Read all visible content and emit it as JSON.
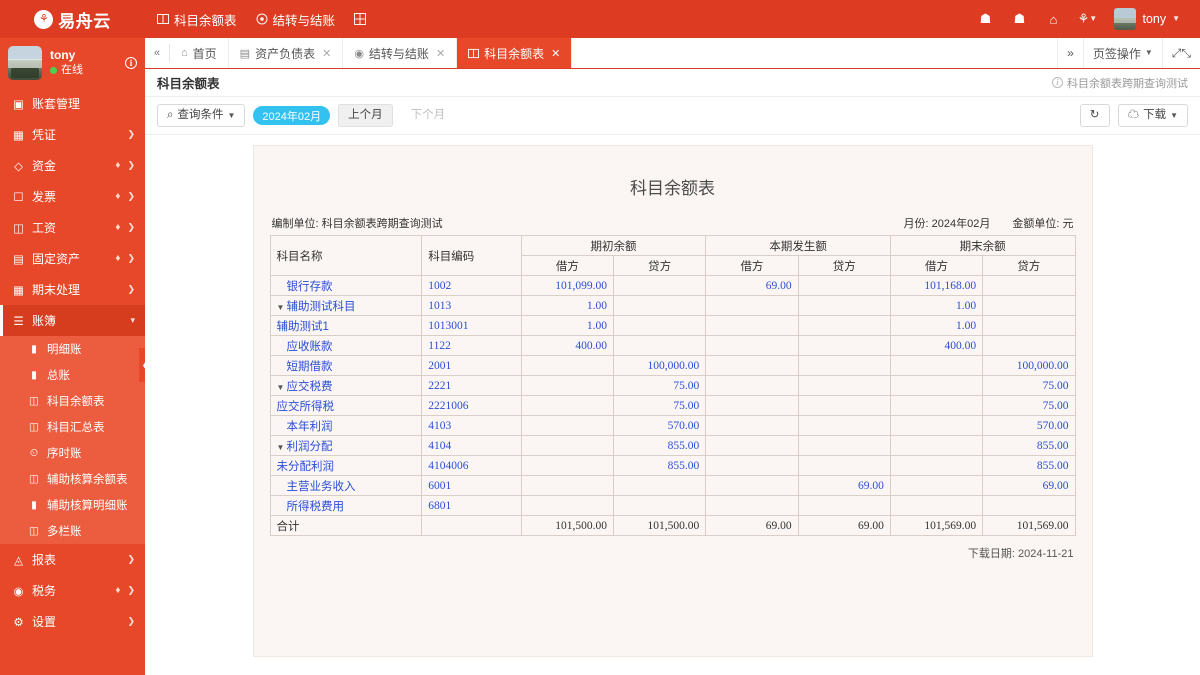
{
  "brand": {
    "name": "易舟云",
    "logo_icon": "seal-logo-icon"
  },
  "topnav": [
    {
      "label": "科目余额表",
      "icon": "columns-icon"
    },
    {
      "label": "结转与结账",
      "icon": "target-icon"
    },
    {
      "label": "",
      "icon": "grid-plus-icon"
    }
  ],
  "topright": {
    "icons": [
      {
        "name": "alert-icon",
        "glyph": "☗"
      },
      {
        "name": "bug-icon",
        "glyph": "☗"
      },
      {
        "name": "home-icon",
        "glyph": "⌂"
      },
      {
        "name": "apps-icon",
        "glyph": "⚘"
      }
    ],
    "user": "tony"
  },
  "sidebar": {
    "profile": {
      "name": "tony",
      "status": "在线",
      "info_icon": "info-icon"
    },
    "items": [
      {
        "label": "账套管理",
        "icon": "book-icon",
        "arrow": false,
        "vip": false
      },
      {
        "label": "凭证",
        "icon": "voucher-icon",
        "arrow": true,
        "vip": false
      },
      {
        "label": "资金",
        "icon": "money-icon",
        "arrow": true,
        "vip": true
      },
      {
        "label": "发票",
        "icon": "invoice-icon",
        "arrow": true,
        "vip": true
      },
      {
        "label": "工资",
        "icon": "salary-icon",
        "arrow": true,
        "vip": true
      },
      {
        "label": "固定资产",
        "icon": "asset-icon",
        "arrow": true,
        "vip": true
      },
      {
        "label": "期末处理",
        "icon": "calendar-icon",
        "arrow": true,
        "vip": false
      },
      {
        "label": "账簿",
        "icon": "ledger-icon",
        "arrow": true,
        "vip": false,
        "active": true
      }
    ],
    "submenu": [
      {
        "label": "明细账",
        "icon": "bookmark-icon"
      },
      {
        "label": "总账",
        "icon": "bookmark-icon"
      },
      {
        "label": "科目余额表",
        "icon": "columns-icon"
      },
      {
        "label": "科目汇总表",
        "icon": "columns-icon"
      },
      {
        "label": "序时账",
        "icon": "clock-icon"
      },
      {
        "label": "辅助核算余额表",
        "icon": "columns-icon"
      },
      {
        "label": "辅助核算明细账",
        "icon": "bookmark-icon"
      },
      {
        "label": "多栏账",
        "icon": "columns-icon"
      }
    ],
    "items_after": [
      {
        "label": "报表",
        "icon": "chart-icon",
        "arrow": true,
        "vip": false
      },
      {
        "label": "税务",
        "icon": "tax-icon",
        "arrow": true,
        "vip": true
      },
      {
        "label": "设置",
        "icon": "gear-icon",
        "arrow": true,
        "vip": false
      }
    ],
    "collapse_handle": "❮"
  },
  "tabbar": {
    "prev_icon": "double-chevron-left-icon",
    "tabs": [
      {
        "label": "首页",
        "icon": "home-icon",
        "closable": false,
        "active": false
      },
      {
        "label": "资产负债表",
        "icon": "balance-icon",
        "closable": true,
        "active": false
      },
      {
        "label": "结转与结账",
        "icon": "target-icon",
        "closable": true,
        "active": false
      },
      {
        "label": "科目余额表",
        "icon": "columns-icon",
        "closable": true,
        "active": true
      }
    ],
    "next_icon": "double-chevron-right-icon",
    "tab_action_label": "页签操作",
    "fullscreen_icon": "fullscreen-icon",
    "close_label": "×"
  },
  "pagehead": {
    "title": "科目余额表",
    "note": "科目余额表跨期查询测试"
  },
  "toolbar": {
    "query_label": "查询条件",
    "period": "2024年02月",
    "prev_month": "上个月",
    "next_month": "下个月",
    "refresh_icon": "refresh-icon",
    "download_label": "下载"
  },
  "report": {
    "title": "科目余额表",
    "unit_label": "编制单位:",
    "unit_value": "科目余额表跨期查询测试",
    "month_label": "月份:",
    "month_value": "2024年02月",
    "amount_label": "金额单位:",
    "amount_value": "元",
    "group_headers": [
      "期初余额",
      "本期发生额",
      "期末余额"
    ],
    "col_name": "科目名称",
    "col_code": "科目编码",
    "sub_headers": [
      "借方",
      "贷方"
    ],
    "rows": [
      {
        "name": "银行存款",
        "level": 1,
        "expandable": false,
        "code": "1002",
        "values": [
          "101,099.00",
          "",
          "69.00",
          "",
          "101,168.00",
          ""
        ]
      },
      {
        "name": "辅助测试科目",
        "level": 1,
        "expandable": true,
        "code": "1013",
        "values": [
          "1.00",
          "",
          "",
          "",
          "1.00",
          ""
        ]
      },
      {
        "name": "辅助测试1",
        "level": 2,
        "expandable": false,
        "code": "1013001",
        "values": [
          "1.00",
          "",
          "",
          "",
          "1.00",
          ""
        ]
      },
      {
        "name": "应收账款",
        "level": 1,
        "expandable": false,
        "code": "1122",
        "values": [
          "400.00",
          "",
          "",
          "",
          "400.00",
          ""
        ]
      },
      {
        "name": "短期借款",
        "level": 1,
        "expandable": false,
        "code": "2001",
        "values": [
          "",
          "100,000.00",
          "",
          "",
          "",
          "100,000.00"
        ]
      },
      {
        "name": "应交税费",
        "level": 1,
        "expandable": true,
        "code": "2221",
        "values": [
          "",
          "75.00",
          "",
          "",
          "",
          "75.00"
        ]
      },
      {
        "name": "应交所得税",
        "level": 2,
        "expandable": false,
        "code": "2221006",
        "values": [
          "",
          "75.00",
          "",
          "",
          "",
          "75.00"
        ]
      },
      {
        "name": "本年利润",
        "level": 1,
        "expandable": false,
        "code": "4103",
        "values": [
          "",
          "570.00",
          "",
          "",
          "",
          "570.00"
        ]
      },
      {
        "name": "利润分配",
        "level": 1,
        "expandable": true,
        "code": "4104",
        "values": [
          "",
          "855.00",
          "",
          "",
          "",
          "855.00"
        ]
      },
      {
        "name": "未分配利润",
        "level": 2,
        "expandable": false,
        "code": "4104006",
        "values": [
          "",
          "855.00",
          "",
          "",
          "",
          "855.00"
        ]
      },
      {
        "name": "主营业务收入",
        "level": 1,
        "expandable": false,
        "code": "6001",
        "values": [
          "",
          "",
          "",
          "69.00",
          "",
          "69.00"
        ]
      },
      {
        "name": "所得税费用",
        "level": 1,
        "expandable": false,
        "code": "6801",
        "values": [
          "",
          "",
          "",
          "",
          "",
          ""
        ]
      }
    ],
    "total": {
      "name": "合计",
      "code": "",
      "values": [
        "101,500.00",
        "101,500.00",
        "69.00",
        "69.00",
        "101,569.00",
        "101,569.00"
      ]
    },
    "download_date_label": "下载日期:",
    "download_date": "2024-11-21"
  },
  "colors": {
    "brand_red": "#dd3c22",
    "sidebar_red": "#e8482a",
    "submenu_red": "#ec5c3e",
    "active_red": "#d63c1e",
    "pill_blue": "#33c2f0",
    "link_blue": "#2b4dd6",
    "sheet_bg": "#fbf6f3"
  }
}
